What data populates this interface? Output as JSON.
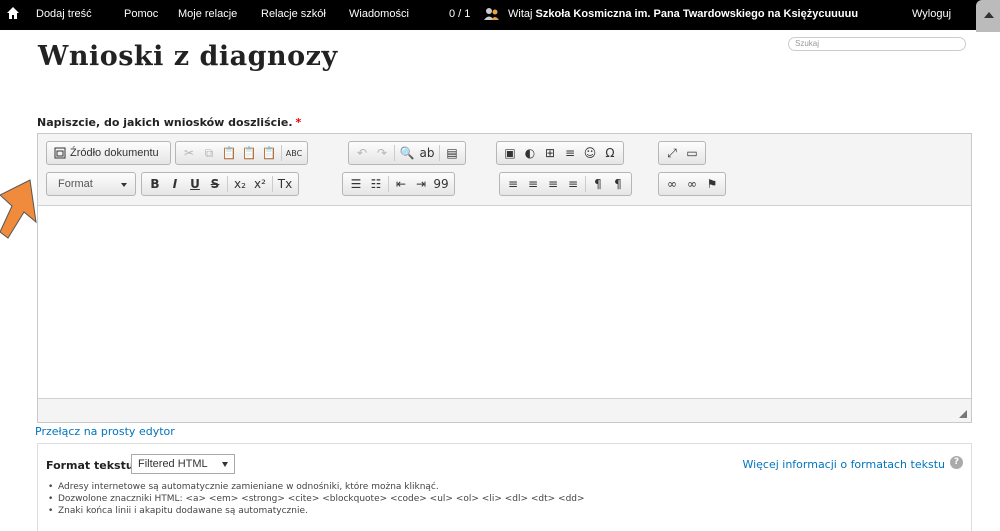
{
  "topbar": {
    "nav": [
      "Dodaj treść",
      "Pomoc",
      "Moje relacje",
      "Relacje szkół",
      "Wiadomości"
    ],
    "counter": "0 / 1",
    "welcome_prefix": "Witaj",
    "user_name": "Szkoła Kosmiczna im. Pana Twardowskiego na Księżycuuuuu",
    "logout": "Wyloguj"
  },
  "search": {
    "placeholder": "Szukaj"
  },
  "page": {
    "title": "Wnioski z diagnozy"
  },
  "field": {
    "label": "Napiszcie, do jakich wniosków doszliście.",
    "required_mark": "*"
  },
  "editor": {
    "source_label": "Źródło dokumentu",
    "format_label": "Format",
    "buttons_row1": [
      {
        "name": "cut-icon",
        "glyph": "✂",
        "disabled": true
      },
      {
        "name": "copy-icon",
        "glyph": "⧉",
        "disabled": true
      },
      {
        "name": "paste-icon",
        "glyph": "📋",
        "disabled": false
      },
      {
        "name": "paste-text-icon",
        "glyph": "📋",
        "disabled": false
      },
      {
        "name": "paste-word-icon",
        "glyph": "📋",
        "disabled": false
      },
      {
        "name": "spellcheck-icon",
        "glyph": "ABC",
        "disabled": false
      },
      {
        "name": "undo-icon",
        "glyph": "↶",
        "disabled": true
      },
      {
        "name": "redo-icon",
        "glyph": "↷",
        "disabled": true
      },
      {
        "name": "find-icon",
        "glyph": "🔍",
        "disabled": false
      },
      {
        "name": "replace-icon",
        "glyph": "ab",
        "disabled": false
      },
      {
        "name": "select-all-icon",
        "glyph": "▤",
        "disabled": false
      },
      {
        "name": "image-icon",
        "glyph": "▣",
        "disabled": false
      },
      {
        "name": "flash-icon",
        "glyph": "◐",
        "disabled": false
      },
      {
        "name": "table-icon",
        "glyph": "⊞",
        "disabled": false
      },
      {
        "name": "horizontal-line-icon",
        "glyph": "≡",
        "disabled": false
      },
      {
        "name": "smiley-icon",
        "glyph": "☺",
        "disabled": false
      },
      {
        "name": "special-char-icon",
        "glyph": "Ω",
        "disabled": false
      },
      {
        "name": "maximize-icon",
        "glyph": "⤢",
        "disabled": false
      },
      {
        "name": "show-blocks-icon",
        "glyph": "▭",
        "disabled": false
      }
    ],
    "buttons_row2": [
      {
        "name": "bold-icon",
        "glyph": "B"
      },
      {
        "name": "italic-icon",
        "glyph": "I"
      },
      {
        "name": "underline-icon",
        "glyph": "U"
      },
      {
        "name": "strike-icon",
        "glyph": "S"
      },
      {
        "name": "subscript-icon",
        "glyph": "x₂"
      },
      {
        "name": "superscript-icon",
        "glyph": "x²"
      },
      {
        "name": "remove-format-icon",
        "glyph": "Tx"
      },
      {
        "name": "numbered-list-icon",
        "glyph": "☰"
      },
      {
        "name": "bulleted-list-icon",
        "glyph": "☷"
      },
      {
        "name": "outdent-icon",
        "glyph": "⇤"
      },
      {
        "name": "indent-icon",
        "glyph": "⇥"
      },
      {
        "name": "blockquote-icon",
        "glyph": "99"
      },
      {
        "name": "align-left-icon",
        "glyph": "≡"
      },
      {
        "name": "align-center-icon",
        "glyph": "≡"
      },
      {
        "name": "align-right-icon",
        "glyph": "≡"
      },
      {
        "name": "justify-icon",
        "glyph": "≡"
      },
      {
        "name": "ltr-icon",
        "glyph": "¶"
      },
      {
        "name": "rtl-icon",
        "glyph": "¶"
      },
      {
        "name": "link-icon",
        "glyph": "∞"
      },
      {
        "name": "unlink-icon",
        "glyph": "∞"
      },
      {
        "name": "anchor-icon",
        "glyph": "⚑"
      }
    ]
  },
  "switch_editor": "Przełącz na prosty edytor",
  "text_format": {
    "label": "Format tekstu",
    "selected": "Filtered HTML",
    "more_info": "Więcej informacji o formatach tekstu",
    "tips": [
      "Adresy internetowe są automatycznie zamieniane w odnośniki, które można kliknąć.",
      "Dozwolone znaczniki HTML: <a> <em> <strong> <cite> <blockquote> <code> <ul> <ol> <li> <dl> <dt> <dd>",
      "Znaki końca linii i akapitu dodawane są automatycznie."
    ]
  },
  "colors": {
    "accent_link": "#0074bd",
    "annotation_arrow": "#f08a3c",
    "topbar": "#000000"
  }
}
